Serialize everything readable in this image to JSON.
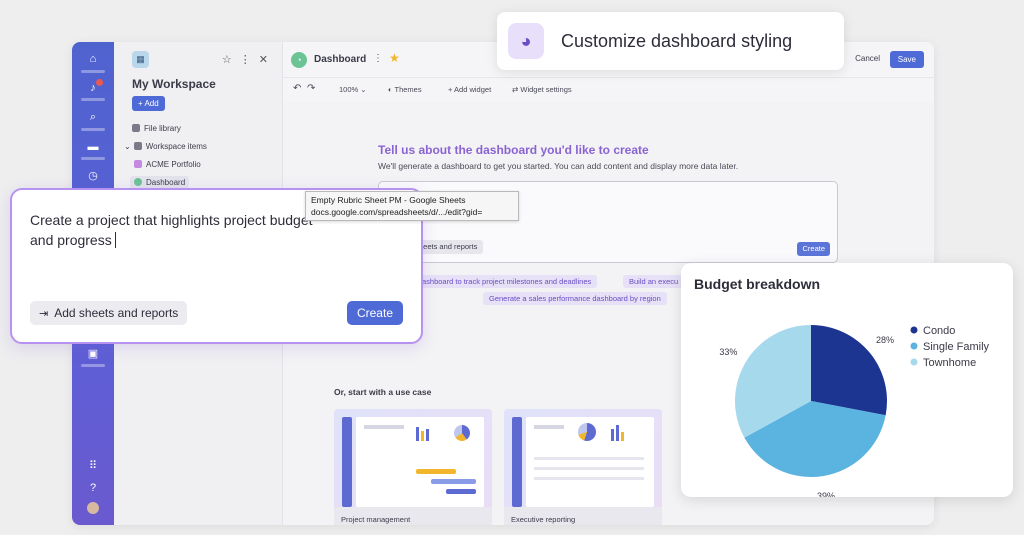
{
  "app": {
    "sidebar": {
      "title": "My Workspace",
      "add_label": "+ Add",
      "items": [
        {
          "label": "File library",
          "color": "#7a7a88"
        },
        {
          "label": "Workspace items",
          "color": "#7a7a88"
        },
        {
          "label": "ACME Portfolio",
          "color": "#c58ae0"
        },
        {
          "label": "Dashboard",
          "color": "#6cc394"
        }
      ]
    },
    "topbar": {
      "title": "Dashboard",
      "cancel_label": "Cancel",
      "save_label": "Save"
    },
    "toolbar": {
      "zoom": "100%",
      "themes": "Themes",
      "add_widget": "+ Add widget",
      "widget_settings": "Widget settings"
    },
    "canvas": {
      "heading": "Tell us about the dashboard you'd like to create",
      "subheading": "We'll generate a dashboard to get you started. You can add content and display more data later.",
      "sheets_label": "heets and reports",
      "create_label": "Create",
      "suggestions": [
        "ashboard to track project milestones and deadlines",
        "Build an execu",
        "Generate a sales performance dashboard by region"
      ],
      "usecase_heading": "Or, start with a use case",
      "usecases": [
        {
          "label": "Project management"
        },
        {
          "label": "Executive reporting"
        }
      ]
    }
  },
  "prompt_card": {
    "text": "Create a project that highlights project budget and progress",
    "sheets_label": "Add sheets and reports",
    "create_label": "Create"
  },
  "tooltip": {
    "title": "Empty Rubric Sheet PM - Google Sheets",
    "url": "docs.google.com/spreadsheets/d/.../edit?gid="
  },
  "customize": {
    "label": "Customize dashboard styling",
    "icon": "palette-icon"
  },
  "chart_data": {
    "type": "pie",
    "title": "Budget breakdown",
    "categories": [
      "Condo",
      "Single Family",
      "Townhome"
    ],
    "values": [
      28,
      39,
      33
    ],
    "value_labels": [
      "28%",
      "39%",
      "33%"
    ],
    "colors": [
      "#1b3591",
      "#5bb3df",
      "#a7d9ed"
    ],
    "legend": "right"
  }
}
